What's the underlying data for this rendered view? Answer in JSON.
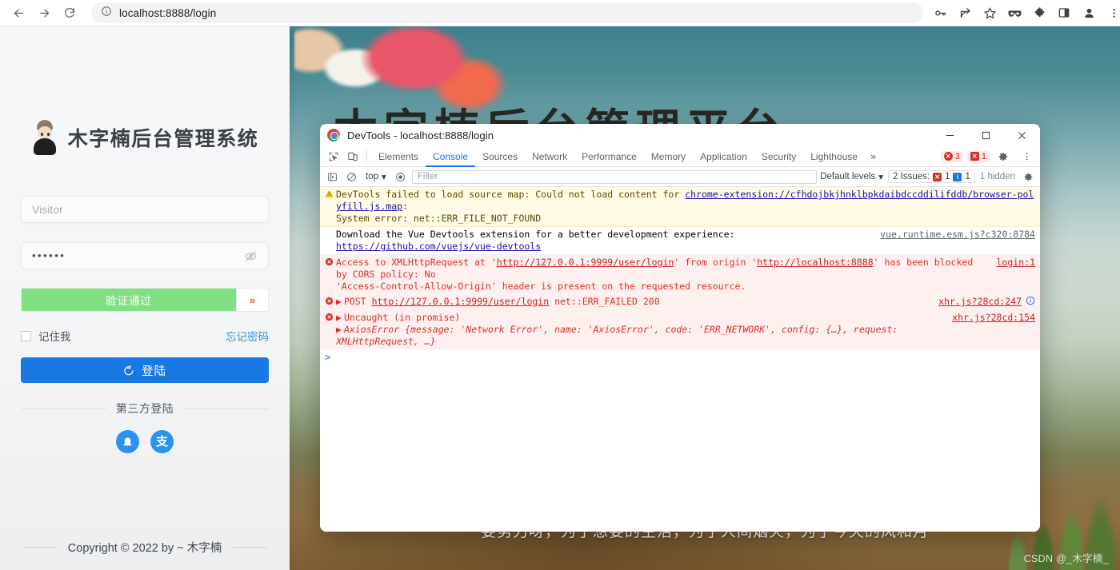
{
  "browser": {
    "back_icon": "arrow-left-icon",
    "forward_icon": "arrow-right-icon",
    "reload_icon": "reload-icon",
    "site_info_icon": "info-circle-icon",
    "url": "localhost:8888/login",
    "toolbar_icons": [
      "key-icon",
      "share-icon",
      "bookmark-star-icon",
      "glasses-icon",
      "extensions-puzzle-icon",
      "side-panel-icon",
      "profile-avatar-icon",
      "kebab-menu-icon"
    ]
  },
  "login": {
    "title": "木字楠后台管理系统",
    "avatar_icon": "user-avatar-icon",
    "username_placeholder": "Visitor",
    "username_value": "",
    "password_value": "••••••",
    "password_toggle_icon": "eye-off-icon",
    "captcha_label": "验证通过",
    "captcha_handle": "»",
    "remember_label": "记住我",
    "forgot_label": "忘记密码",
    "login_button": "登陆",
    "login_icon": "login-arrow-icon",
    "third_party_label": "第三方登陆",
    "socials": [
      {
        "name": "qq",
        "icon": "qq-penguin-icon",
        "glyph": ""
      },
      {
        "name": "alipay",
        "icon": "alipay-icon",
        "glyph": "支"
      }
    ],
    "copyright": "Copyright © 2022 by ~ 木字楠"
  },
  "background": {
    "page_title": "木字楠后台管理平台",
    "quote": "要努力呀，为了想要的生活，为了人间烟火，为了今天的风和月",
    "watermark": "CSDN @_木字楠_"
  },
  "devtools": {
    "window_title": "DevTools - localhost:8888/login",
    "minimize_icon": "minimize-icon",
    "maximize_icon": "maximize-icon",
    "close_icon": "close-icon",
    "inspect_icon": "inspect-element-icon",
    "device_icon": "device-toolbar-icon",
    "tabs": [
      {
        "label": "Elements",
        "active": false
      },
      {
        "label": "Console",
        "active": true
      },
      {
        "label": "Sources",
        "active": false
      },
      {
        "label": "Network",
        "active": false
      },
      {
        "label": "Performance",
        "active": false
      },
      {
        "label": "Memory",
        "active": false
      },
      {
        "label": "Application",
        "active": false
      },
      {
        "label": "Security",
        "active": false
      },
      {
        "label": "Lighthouse",
        "active": false
      }
    ],
    "more_tabs": "»",
    "error_badge": "3",
    "warning_badge": "1",
    "settings_icon": "gear-icon",
    "kebab_icon": "kebab-menu-icon",
    "console_toolbar": {
      "sidebar_icon": "console-sidebar-icon",
      "clear_icon": "clear-console-icon",
      "context": "top",
      "eye_icon": "live-expression-icon",
      "filter_placeholder": "Filter",
      "levels": "Default levels",
      "issues_label": "2 Issues:",
      "issues_error_count": "1",
      "issues_info_count": "1",
      "hidden_count": "1 hidden",
      "settings_icon": "gear-icon"
    },
    "logs": [
      {
        "type": "warning",
        "icon": "warning-triangle-icon",
        "text_before": "DevTools failed to load source map: Could not load content for ",
        "link": "chrome-extension://cfhdojbkjhnklbpkdaibdccddilifddb/browser-polyfill.js.map",
        "text_after": ":",
        "line2": "System error: net::ERR_FILE_NOT_FOUND",
        "source": ""
      },
      {
        "type": "info",
        "text_before": "Download the Vue Devtools extension for a better development experience:",
        "link": "https://github.com/vuejs/vue-devtools",
        "source": "vue.runtime.esm.js?c320:8784"
      },
      {
        "type": "error",
        "icon": "error-circle-icon",
        "text_before": "Access to XMLHttpRequest at '",
        "link1": "http://127.0.0.1:9999/user/login",
        "text_mid": "' from origin '",
        "link2": "http://localhost:8888",
        "text_after": "' has been blocked by CORS policy: No",
        "line2": "'Access-Control-Allow-Origin' header is present on the requested resource.",
        "source": "login:1"
      },
      {
        "type": "error",
        "icon": "error-circle-icon",
        "method": "POST",
        "link1": "http://127.0.0.1:9999/user/login",
        "text_after": "net::ERR_FAILED 200",
        "source": "xhr.js?28cd:247"
      },
      {
        "type": "error",
        "icon": "error-circle-icon",
        "text_before": "Uncaught (in promise)",
        "detail_name": "AxiosError",
        "detail": " {message: 'Network Error', name: 'AxiosError', code: 'ERR_NETWORK', config: {…}, request: XMLHttpRequest, …}",
        "source": "xhr.js?28cd:154"
      }
    ],
    "prompt": ">"
  }
}
